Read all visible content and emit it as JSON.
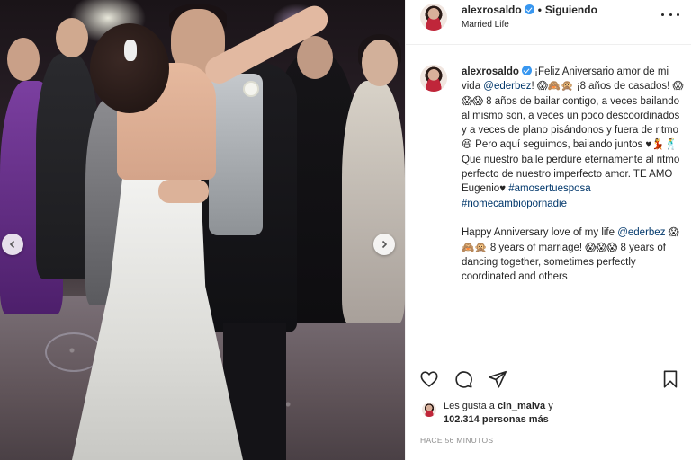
{
  "header": {
    "username": "alexrosaldo",
    "separator": "•",
    "follow_status": "Siguiendo",
    "subtitle": "Married Life",
    "more_icon": "more-horizontal-icon"
  },
  "post": {
    "photo_icons": {
      "prev": "chevron-left-icon",
      "next": "chevron-right-icon"
    },
    "caption": {
      "username": "alexrosaldo",
      "part1": " ¡Feliz Aniversario amor de mi vida ",
      "mention1": "@ederbez",
      "part2": "! 😱🙈🙊 ¡8 años de casados! 😱😱😱 8 años de bailar contigo, a veces bailando al mismo son, a veces un poco descoordinados y a veces de plano pisándonos y fuera de ritmo😆 Pero aquí seguimos, bailando juntos ♥💃🕺 Que nuestro baile perdure eternamente al ritmo perfecto de nuestro imperfecto amor. TE AMO Eugenio♥ ",
      "hashtag1": "#amosertuesposa",
      "hashtag2": "#nomecambiopornadie",
      "part3": "Happy Anniversary love of my life ",
      "mention2": "@ederbez",
      "part4": " 😱🙈🙊 8 years of marriage! 😱😱😱 8 years of dancing together, sometimes perfectly coordinated and others"
    }
  },
  "actions": {
    "icons": [
      "heart-icon",
      "comment-icon",
      "share-icon",
      "bookmark-icon"
    ]
  },
  "likes": {
    "prefix": "Les gusta a ",
    "user": "cin_malva",
    "middle": " y",
    "count": "102.314 personas más"
  },
  "timestamp": "HACE 56 MINUTOS",
  "colors": {
    "verified": "#3897f0",
    "link": "#00376b",
    "text": "#262626",
    "muted": "#8e8e8e",
    "divider": "#efefef"
  }
}
